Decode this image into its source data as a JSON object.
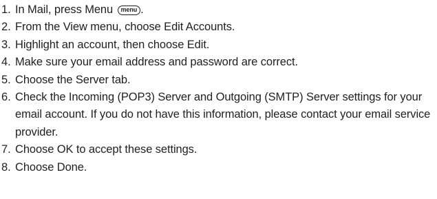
{
  "steps": [
    {
      "number": "1.",
      "text": "In Mail, press Menu",
      "key_label": "menu",
      "suffix": "."
    },
    {
      "number": "2.",
      "text": "From the View menu, choose Edit Accounts."
    },
    {
      "number": "3.",
      "text": "Highlight an account, then choose Edit."
    },
    {
      "number": "4.",
      "text": "Make sure your email address and password are correct."
    },
    {
      "number": "5.",
      "text": "Choose the Server tab."
    },
    {
      "number": "6.",
      "text": "Check the Incoming (POP3) Server and Outgoing (SMTP) Server settings for your email account. If you do not have this information, please contact your email service provider."
    },
    {
      "number": "7.",
      "text": "Choose OK to accept these settings."
    },
    {
      "number": "8.",
      "text": "Choose Done."
    }
  ]
}
